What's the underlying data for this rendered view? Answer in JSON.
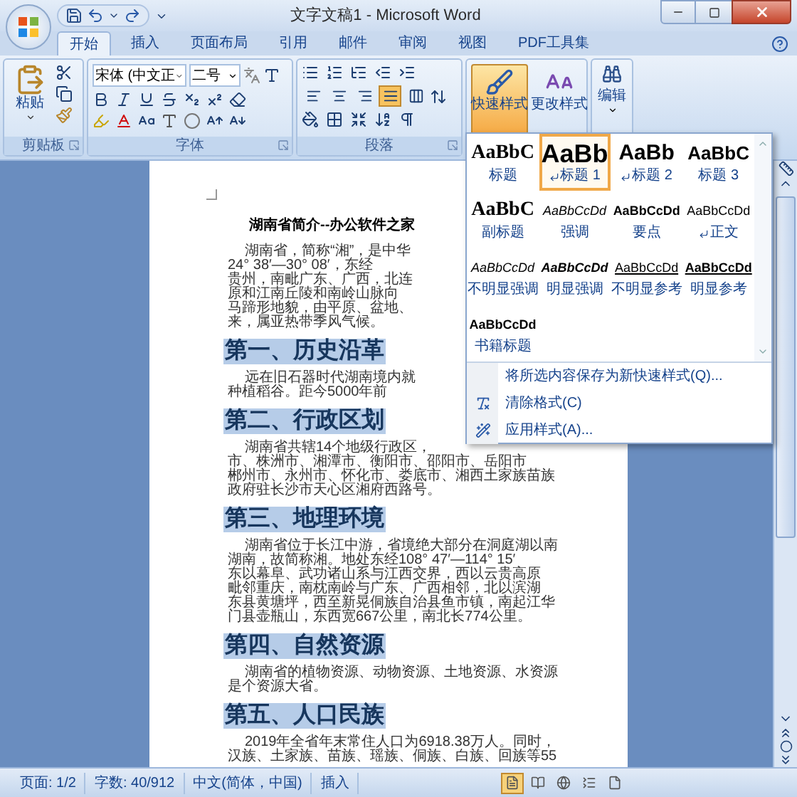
{
  "window": {
    "title": "文字文稿1 - Microsoft Word"
  },
  "tabs": [
    {
      "label": "开始",
      "selected": true
    },
    {
      "label": "插入",
      "selected": false
    },
    {
      "label": "页面布局",
      "selected": false
    },
    {
      "label": "引用",
      "selected": false
    },
    {
      "label": "邮件",
      "selected": false
    },
    {
      "label": "审阅",
      "selected": false
    },
    {
      "label": "视图",
      "selected": false
    },
    {
      "label": "PDF工具集",
      "selected": false
    }
  ],
  "ribbon": {
    "clipboard": {
      "paste_label": "粘贴",
      "group_label": "剪贴板"
    },
    "font": {
      "font_name": "宋体 (中文正",
      "font_size": "二号",
      "group_label": "字体"
    },
    "paragraph": {
      "group_label": "段落",
      "alignment": [
        {
          "kind": "left",
          "selected": false
        },
        {
          "kind": "center",
          "selected": false
        },
        {
          "kind": "right",
          "selected": false
        },
        {
          "kind": "justify",
          "selected": true
        },
        {
          "kind": "distributed",
          "selected": false
        }
      ]
    },
    "styles": {
      "quick_styles": {
        "label": "快速样式",
        "pressed": true
      },
      "change_styles": {
        "label": "更改样式",
        "pressed": false
      }
    },
    "editing": {
      "label": "编辑"
    }
  },
  "style_gallery": {
    "items": [
      {
        "preview": "AaBbC",
        "name": "标题",
        "kind": "title",
        "paragraph_mark": false,
        "selected": false
      },
      {
        "preview": "AaBb",
        "name": "标题 1",
        "kind": "heading1",
        "paragraph_mark": true,
        "selected": true
      },
      {
        "preview": "AaBb",
        "name": "标题 2",
        "kind": "heading2",
        "paragraph_mark": true,
        "selected": false
      },
      {
        "preview": "AaBbC",
        "name": "标题 3",
        "kind": "heading3",
        "paragraph_mark": false,
        "selected": false
      },
      {
        "preview": "AaBbC",
        "name": "副标题",
        "kind": "subtitle",
        "paragraph_mark": false,
        "selected": false
      },
      {
        "preview": "AaBbCcDd",
        "name": "强调",
        "kind": "emphasis",
        "paragraph_mark": false,
        "selected": false
      },
      {
        "preview": "AaBbCcDd",
        "name": "要点",
        "kind": "strong",
        "paragraph_mark": false,
        "selected": false
      },
      {
        "preview": "AaBbCcDd",
        "name": "正文",
        "kind": "normal",
        "paragraph_mark": true,
        "selected": false
      },
      {
        "preview": "AaBbCcDd",
        "name": "不明显强调",
        "kind": "subtle_emphasis",
        "paragraph_mark": false,
        "selected": false
      },
      {
        "preview": "AaBbCcDd",
        "name": "明显强调",
        "kind": "intense_emphasis",
        "paragraph_mark": false,
        "selected": false
      },
      {
        "preview": "AaBbCcDd",
        "name": "不明显参考",
        "kind": "subtle_reference",
        "paragraph_mark": false,
        "selected": false
      },
      {
        "preview": "AaBbCcDd",
        "name": "明显参考",
        "kind": "intense_reference",
        "paragraph_mark": false,
        "selected": false
      },
      {
        "preview": "AaBbCcDd",
        "name": "书籍标题",
        "kind": "book_title",
        "paragraph_mark": false,
        "selected": false
      }
    ],
    "menu": [
      {
        "label": "将所选内容保存为新快速样式(Q)...",
        "kind": "save"
      },
      {
        "label": "清除格式(C)",
        "kind": "clear"
      },
      {
        "label": "应用样式(A)...",
        "kind": "apply"
      }
    ]
  },
  "document": {
    "blocks": [
      {
        "kind": "title",
        "text": "湖南省简介--办公软件之家"
      },
      {
        "kind": "body",
        "lines": [
          "湖南省，简称“湘”，是中华",
          "24° 38′—30° 08′，东经",
          "贵州，南毗广东、广西，北连",
          "原和江南丘陵和南岭山脉向",
          "马蹄形地貌，由平原、盆地、",
          "来，属亚热带季风气候。"
        ]
      },
      {
        "kind": "heading",
        "text": "第一、历史沿革"
      },
      {
        "kind": "body",
        "lines": [
          "远在旧石器时代湖南境内就",
          "种植稻谷。距今5000年前"
        ]
      },
      {
        "kind": "heading",
        "text": "第二、行政区划"
      },
      {
        "kind": "body",
        "lines": [
          "湖南省共辖14个地级行政区，",
          "市、株洲市、湘潭市、衡阳市、邵阳市、岳阳市",
          "郴州市、永州市、怀化市、娄底市、湘西土家族苗族",
          "政府驻长沙市天心区湘府西路号。"
        ]
      },
      {
        "kind": "heading",
        "text": "第三、地理环境"
      },
      {
        "kind": "body",
        "lines": [
          "湖南省位于长江中游，省境绝大部分在洞庭湖以南",
          "湖南，故简称湘。地处东经108° 47′—114° 15′",
          "东以幕阜、武功诸山系与江西交界，西以云贵高原",
          "毗邻重庆，南枕南岭与广东、广西相邻，北以滨湖",
          "东县黄塘坪，西至新晃侗族自治县鱼市镇，南起江华",
          "门县壶瓶山，东西宽667公里，南北长774公里。"
        ]
      },
      {
        "kind": "heading",
        "text": "第四、自然资源"
      },
      {
        "kind": "body",
        "lines": [
          "湖南省的植物资源、动物资源、土地资源、水资源",
          "是个资源大省。"
        ]
      },
      {
        "kind": "heading",
        "text": "第五、人口民族"
      },
      {
        "kind": "body",
        "lines": [
          "2019年全省年末常住人口为6918.38万人。同时，",
          "汉族、土家族、苗族、瑶族、侗族、白族、回族等55"
        ]
      }
    ]
  },
  "status_bar": {
    "items": [
      "页面: 1/2",
      "字数: 40/912",
      "中文(简体，中国)",
      "插入"
    ],
    "views": [
      {
        "kind": "print",
        "selected": true
      },
      {
        "kind": "reading",
        "selected": false
      },
      {
        "kind": "web",
        "selected": false
      },
      {
        "kind": "outline",
        "selected": false
      },
      {
        "kind": "draft",
        "selected": false
      }
    ]
  }
}
